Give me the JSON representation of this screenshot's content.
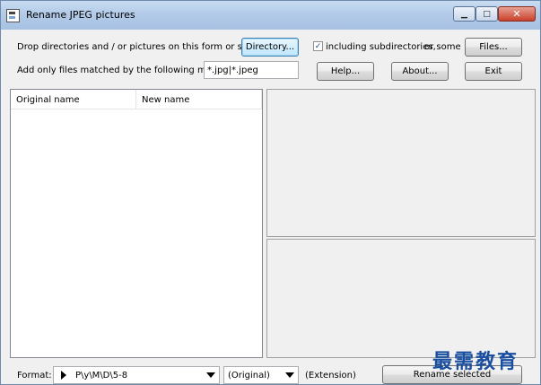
{
  "window": {
    "title": "Rename JPEG pictures"
  },
  "titlebar_buttons": {
    "minimize": "▁",
    "maximize": "□",
    "close": "✕"
  },
  "top": {
    "drop_text": "Drop directories and / or pictures on this form or select a",
    "directory_button": "Directory...",
    "include_subdirs_checked": true,
    "include_subdirs_label": "including subdirectories,",
    "or_some_text": "or some",
    "files_button": "Files...",
    "mask_label": "Add only files matched by the following mask(s) :",
    "mask_value": "*.jpg|*.jpeg",
    "help_button": "Help...",
    "about_button": "About...",
    "exit_button": "Exit"
  },
  "list": {
    "columns": [
      "Original name",
      "New name"
    ],
    "rows": []
  },
  "bottom": {
    "format_label": "Format:",
    "format_value": "P\\y\\M\\D\\5-8",
    "original_select": "(Original)",
    "extension_label": "(Extension)",
    "rename_button": "Rename selected"
  },
  "watermark": "最需教育"
}
